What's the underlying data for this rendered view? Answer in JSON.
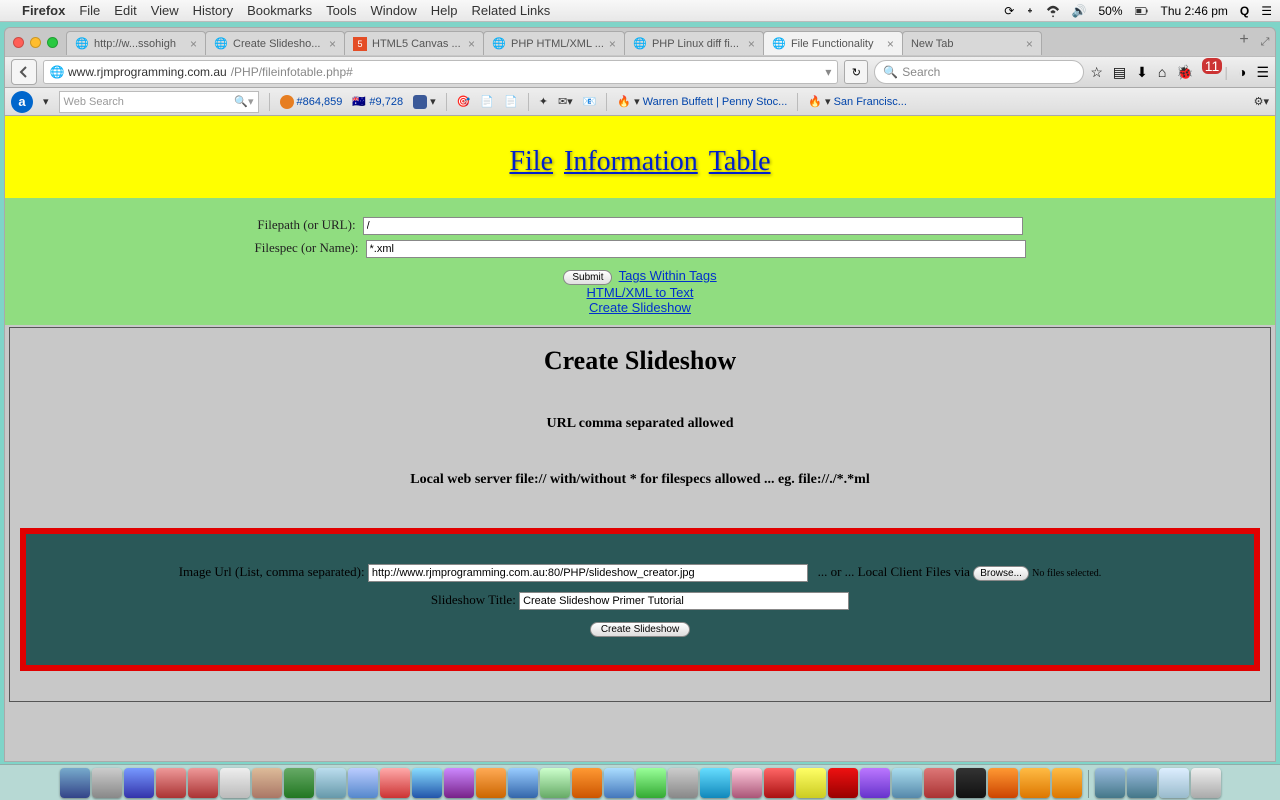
{
  "menubar": {
    "app": "Firefox",
    "items": [
      "File",
      "Edit",
      "View",
      "History",
      "Bookmarks",
      "Tools",
      "Window",
      "Help",
      "Related Links"
    ],
    "battery": "50%",
    "clock": "Thu 2:46 pm"
  },
  "tabs": [
    {
      "label": "http://w...ssohigh",
      "active": false
    },
    {
      "label": "Create Slidesho...",
      "active": false
    },
    {
      "label": "HTML5 Canvas ...",
      "active": false
    },
    {
      "label": "PHP HTML/XML ...",
      "active": false
    },
    {
      "label": "PHP Linux diff fi...",
      "active": false
    },
    {
      "label": "File Functionality",
      "active": true
    },
    {
      "label": "New Tab",
      "active": false
    }
  ],
  "url": {
    "host": "www.rjmprogramming.com.au",
    "path": "/PHP/fileinfotable.php#"
  },
  "search_placeholder": "Search",
  "notif_badge": "11",
  "bookmark_bar": {
    "web_search_placeholder": "Web Search",
    "alexa": "#864,859",
    "flag_num": "#9,728",
    "links": [
      "Warren Buffett | Penny Stoc...",
      "San Francisc..."
    ]
  },
  "page": {
    "title_words": [
      "File",
      "Information",
      "Table"
    ],
    "filepath_label": "Filepath (or URL):",
    "filepath_value": "/",
    "filespec_label": "Filespec (or Name):",
    "filespec_value": "*.xml",
    "submit_label": "Submit",
    "link_tags": "Tags Within Tags",
    "link_htmlxml": "HTML/XML to Text",
    "link_slideshow": "Create Slideshow",
    "h2": "Create Slideshow",
    "sub1": "URL comma separated allowed",
    "sub2": "Local web server file:// with/without * for filespecs allowed ... eg. file://./*.*ml",
    "imgurl_label": "Image Url (List, comma separated):",
    "imgurl_value": "http://www.rjmprogramming.com.au:80/PHP/slideshow_creator.jpg",
    "orlocal": "... or ... Local Client Files via",
    "browse_label": "Browse...",
    "nofiles": "No files selected.",
    "title_label": "Slideshow Title:",
    "title_value": "Create Slideshow Primer Tutorial",
    "create_label": "Create Slideshow"
  }
}
